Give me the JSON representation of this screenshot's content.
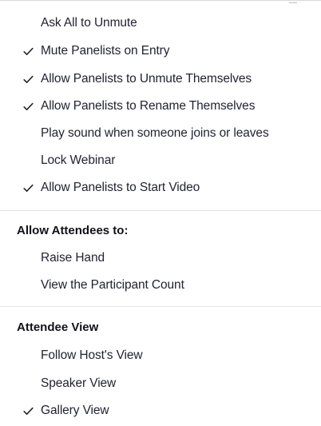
{
  "host_options": [
    {
      "id": "ask-all-to-unmute",
      "label": "Ask All to Unmute",
      "checked": false
    },
    {
      "id": "mute-panelists-on-entry",
      "label": "Mute Panelists on Entry",
      "checked": true
    },
    {
      "id": "allow-panelists-unmute",
      "label": "Allow Panelists to Unmute Themselves",
      "checked": true
    },
    {
      "id": "allow-panelists-rename",
      "label": "Allow Panelists to Rename Themselves",
      "checked": true
    },
    {
      "id": "play-sound-join-leave",
      "label": "Play sound when someone joins or leaves",
      "checked": false
    },
    {
      "id": "lock-webinar",
      "label": "Lock Webinar",
      "checked": false
    },
    {
      "id": "allow-panelists-start-video",
      "label": "Allow Panelists to Start Video",
      "checked": true
    }
  ],
  "attendees_section": {
    "heading": "Allow Attendees to:",
    "items": [
      {
        "id": "raise-hand",
        "label": "Raise Hand",
        "checked": false
      },
      {
        "id": "view-participant-count",
        "label": "View the Participant Count",
        "checked": false
      }
    ]
  },
  "attendee_view_section": {
    "heading": "Attendee View",
    "items": [
      {
        "id": "follow-hosts-view",
        "label": "Follow Host's View",
        "checked": false
      },
      {
        "id": "speaker-view",
        "label": "Speaker View",
        "checked": false
      },
      {
        "id": "gallery-view",
        "label": "Gallery View",
        "checked": true
      }
    ]
  },
  "colors": {
    "text": "#232333",
    "heading": "#111118",
    "divider": "#e2e2e2",
    "background": "#ffffff"
  },
  "icons": {
    "check": "checkmark-icon"
  }
}
